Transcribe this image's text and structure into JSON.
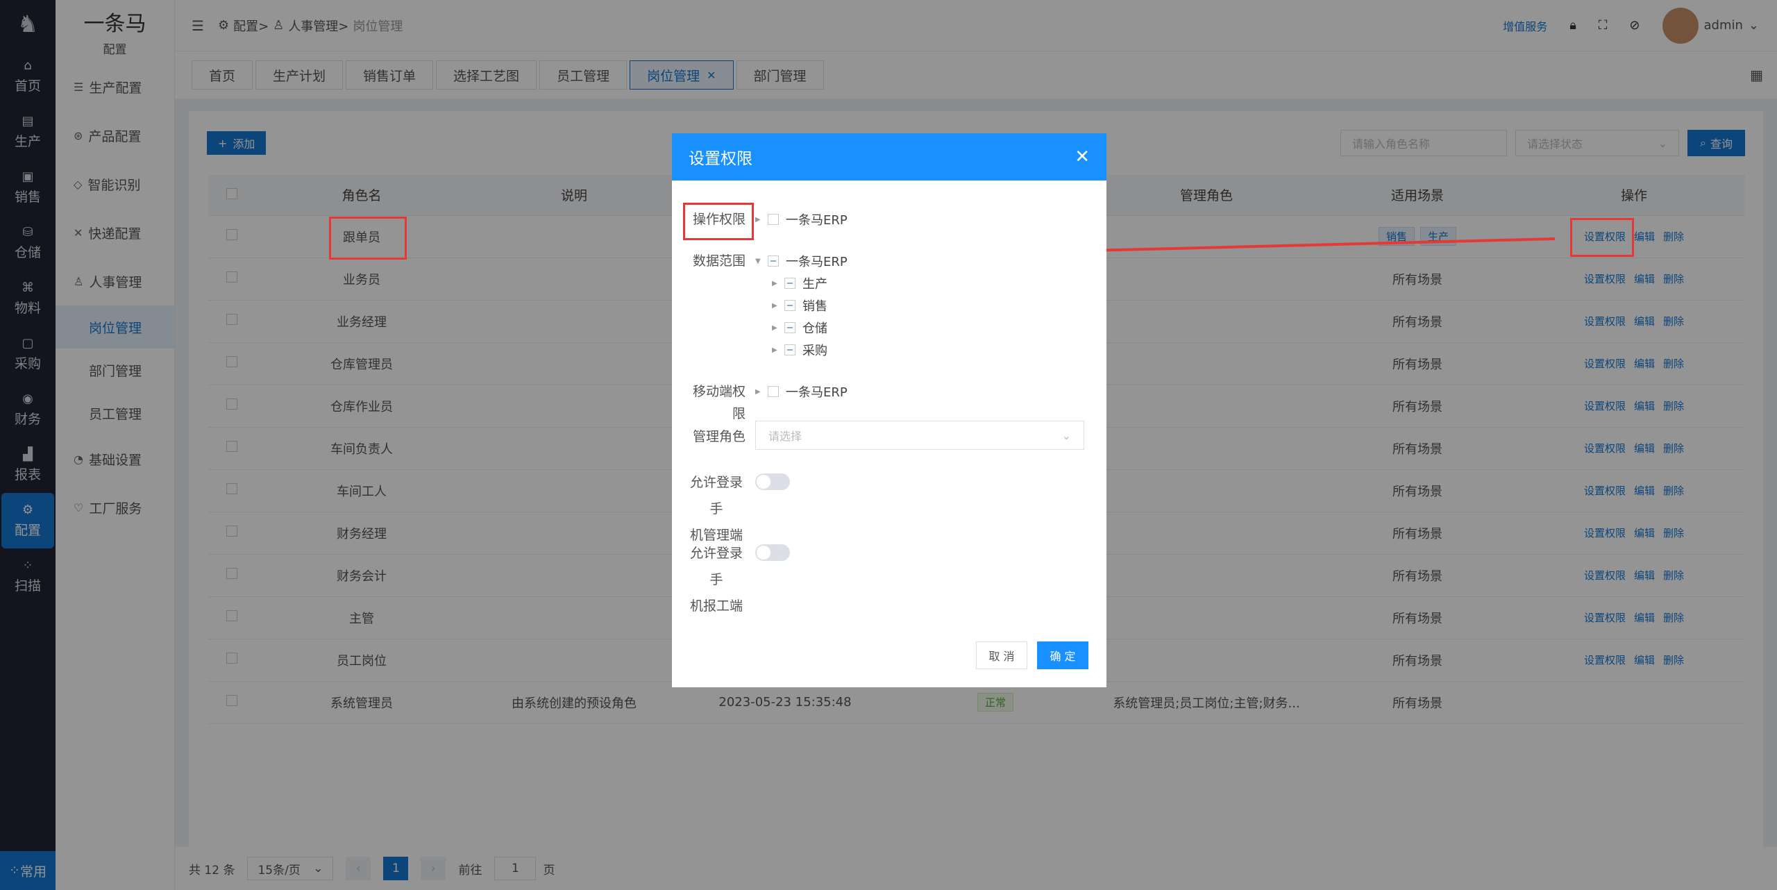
{
  "iconbar": {
    "items": [
      {
        "label": "首页",
        "icon": "home-icon",
        "glyph": "⌂"
      },
      {
        "label": "生产",
        "icon": "production-icon",
        "glyph": "▤"
      },
      {
        "label": "销售",
        "icon": "sales-icon",
        "glyph": "▣"
      },
      {
        "label": "仓储",
        "icon": "warehouse-icon",
        "glyph": "⛁"
      },
      {
        "label": "物料",
        "icon": "material-icon",
        "glyph": "⌘"
      },
      {
        "label": "采购",
        "icon": "purchase-icon",
        "glyph": "▢"
      },
      {
        "label": "财务",
        "icon": "finance-icon",
        "glyph": "◉"
      },
      {
        "label": "报表",
        "icon": "report-icon",
        "glyph": "▟"
      },
      {
        "label": "配置",
        "icon": "config-icon",
        "glyph": "⚙"
      },
      {
        "label": "扫描",
        "icon": "scan-icon",
        "glyph": "⁘"
      }
    ],
    "bottom_label": "常用"
  },
  "submenu": {
    "title": "一条马",
    "subtitle": "配置",
    "items": [
      {
        "label": "生产配置",
        "glyph": "☰"
      },
      {
        "label": "产品配置",
        "glyph": "⊛"
      },
      {
        "label": "智能识别",
        "glyph": "◇"
      },
      {
        "label": "快递配置",
        "glyph": "✕"
      },
      {
        "label": "人事管理",
        "glyph": "♙"
      }
    ],
    "hr_children": [
      "岗位管理",
      "部门管理",
      "员工管理"
    ],
    "tail_items": [
      {
        "label": "基础设置",
        "glyph": "◔"
      },
      {
        "label": "工厂服务",
        "glyph": "♡"
      }
    ]
  },
  "header": {
    "breadcrumb": [
      "配置>",
      "人事管理>",
      "岗位管理"
    ],
    "value_added": "增值服务",
    "username": "admin"
  },
  "tabs": [
    "首页",
    "生产计划",
    "销售订单",
    "选择工艺图",
    "员工管理",
    "岗位管理",
    "部门管理"
  ],
  "toolbar": {
    "add_label": "添加",
    "role_placeholder": "请输入角色名称",
    "status_placeholder": "请选择状态",
    "query_label": "查询"
  },
  "table": {
    "columns": [
      "角色名",
      "说明",
      "",
      "",
      "管理角色",
      "适用场景",
      "操作"
    ],
    "rows": [
      {
        "name": "跟单员",
        "desc": "",
        "time": "",
        "status": "",
        "manage": "",
        "scene_tags": [
          "销售",
          "生产"
        ],
        "scene": "",
        "ops": true
      },
      {
        "name": "业务员",
        "scene": "所有场景",
        "ops": true
      },
      {
        "name": "业务经理",
        "scene": "所有场景",
        "ops": true
      },
      {
        "name": "仓库管理员",
        "scene": "所有场景",
        "ops": true
      },
      {
        "name": "仓库作业员",
        "scene": "所有场景",
        "ops": true
      },
      {
        "name": "车间负责人",
        "scene": "所有场景",
        "ops": true
      },
      {
        "name": "车间工人",
        "scene": "所有场景",
        "ops": true
      },
      {
        "name": "财务经理",
        "scene": "所有场景",
        "ops": true
      },
      {
        "name": "财务会计",
        "scene": "所有场景",
        "ops": true
      },
      {
        "name": "主管",
        "scene": "所有场景",
        "ops": true
      },
      {
        "name": "员工岗位",
        "scene": "所有场景",
        "ops": true
      },
      {
        "name": "系统管理员",
        "desc": "由系统创建的预设角色",
        "time": "2023-05-23 15:35:48",
        "status": "正常",
        "manage": "系统管理员;员工岗位;主管;财务...",
        "scene": "所有场景",
        "ops": false
      }
    ],
    "op_labels": {
      "perm": "设置权限",
      "edit": "编辑",
      "del": "删除"
    }
  },
  "pager": {
    "total": "共 12 条",
    "page_size": "15条/页",
    "current": "1",
    "goto_prefix": "前往",
    "goto_value": "1",
    "goto_suffix": "页"
  },
  "modal": {
    "title": "设置权限",
    "op_perm_label": "操作权限",
    "op_perm_root": "一条马ERP",
    "data_scope_label": "数据范围",
    "data_scope_root": "一条马ERP",
    "data_scope_children": [
      "生产",
      "销售",
      "仓储",
      "采购"
    ],
    "mobile_label": "移动端权限",
    "mobile_root": "一条马ERP",
    "manage_role_label": "管理角色",
    "manage_role_placeholder": "请选择",
    "allow_mgmt_line1": "允许登录手",
    "allow_mgmt_line2": "机管理端",
    "allow_report_line1": "允许登录手",
    "allow_report_line2": "机报工端",
    "cancel_label": "取 消",
    "ok_label": "确 定"
  },
  "colors": {
    "primary": "#1677d2",
    "modal_header": "#1990ff",
    "highlight": "#e53935"
  }
}
